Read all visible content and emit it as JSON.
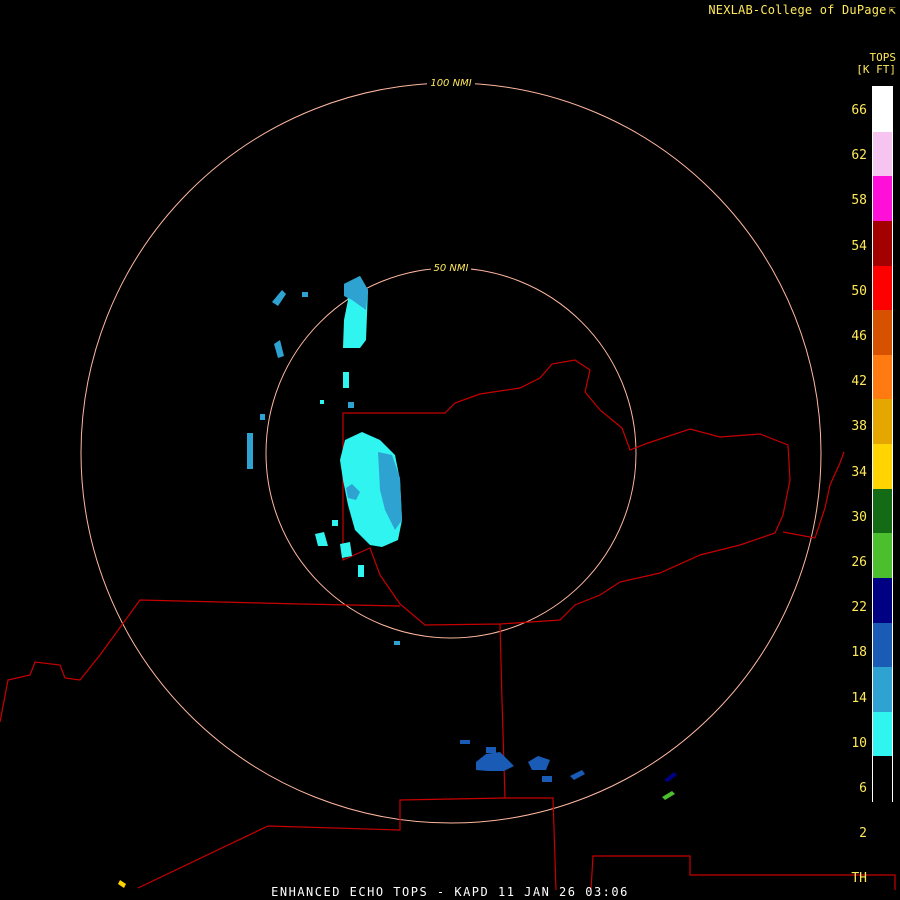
{
  "credit": "NEXLAB-College of DuPage",
  "credit_icon": "external-link-icon",
  "legend": {
    "title_line1": "TOPS",
    "title_line2": "[K FT]",
    "ticks": [
      "66",
      "62",
      "58",
      "54",
      "50",
      "46",
      "42",
      "38",
      "34",
      "30",
      "26",
      "22",
      "18",
      "14",
      "10",
      "6",
      "2",
      "TH"
    ],
    "colors": [
      "#ffffff",
      "#f7c4f0",
      "#ff10d8",
      "#a30000",
      "#ff0000",
      "#d65200",
      "#ff7a10",
      "#e6a600",
      "#ffd400",
      "#136b16",
      "#4cbf2f",
      "#000083",
      "#1a5bb6",
      "#2ea3d2",
      "#30f4f0",
      "#000000"
    ]
  },
  "range_rings": {
    "inner_label": "50 NMI",
    "outer_label": "100 NMI",
    "color": "#ffb8a0"
  },
  "borders_color": "#c80000",
  "caption": "ENHANCED ECHO TOPS - KAPD 11 JAN 26 03:06"
}
